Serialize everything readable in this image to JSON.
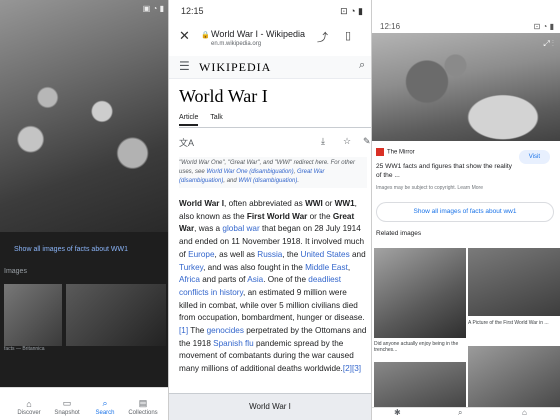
{
  "left": {
    "status_icons": "▣ ◔ ▮",
    "show_all": "Show all images of facts about WW1",
    "section": "Images",
    "thumb_caption": "facts — Britannica",
    "nav": [
      {
        "icon": "⌂",
        "label": "Discover"
      },
      {
        "icon": "▭",
        "label": "Snapshot"
      },
      {
        "icon": "⌕",
        "label": "Search"
      },
      {
        "icon": "▤",
        "label": "Collections"
      }
    ]
  },
  "mid": {
    "status_time": "12:15",
    "status_right": "⊡ ◔ ▮",
    "browser": {
      "close": "✕",
      "lock": "🔒",
      "title": "World War I - Wikipedia",
      "url": "en.m.wikipedia.org",
      "share": "⤴",
      "bookmark": "▯"
    },
    "wiki": {
      "menu": "☰",
      "logo": "WIKIPEDIA",
      "search": "⌕",
      "heading": "World War I",
      "tabs": [
        "Article",
        "Talk"
      ],
      "tools": {
        "lang": "文A",
        "download": "⤓",
        "star": "☆",
        "edit": "✎"
      },
      "hatnote_1": "\"World War One\", \"Great War\", and \"WWI\" redirect here. For other uses, see ",
      "hatnote_link_1": "World War One (disambiguation)",
      "hatnote_2": ", ",
      "hatnote_link_2": "Great War (disambiguation)",
      "hatnote_3": ", and ",
      "hatnote_link_3": "WWI (disambiguation)",
      "hatnote_end": ".",
      "body": [
        {
          "t": "b",
          "v": "World War I"
        },
        {
          "t": "",
          "v": ", often abbreviated as "
        },
        {
          "t": "b",
          "v": "WWI"
        },
        {
          "t": "",
          "v": " or "
        },
        {
          "t": "b",
          "v": "WW1"
        },
        {
          "t": "",
          "v": ", also known as the "
        },
        {
          "t": "b",
          "v": "First World War"
        },
        {
          "t": "",
          "v": " or the "
        },
        {
          "t": "b",
          "v": "Great War"
        },
        {
          "t": "",
          "v": ", was a "
        },
        {
          "t": "a",
          "v": "global war"
        },
        {
          "t": "",
          "v": " that began on 28 July 1914 and ended on 11 November 1918. It involved much of "
        },
        {
          "t": "a",
          "v": "Europe"
        },
        {
          "t": "",
          "v": ", as well as "
        },
        {
          "t": "a",
          "v": "Russia"
        },
        {
          "t": "",
          "v": ", the "
        },
        {
          "t": "a",
          "v": "United States"
        },
        {
          "t": "",
          "v": " and "
        },
        {
          "t": "a",
          "v": "Turkey"
        },
        {
          "t": "",
          "v": ", and was also fought in the "
        },
        {
          "t": "a",
          "v": "Middle East"
        },
        {
          "t": "",
          "v": ", "
        },
        {
          "t": "a",
          "v": "Africa"
        },
        {
          "t": "",
          "v": " and parts of "
        },
        {
          "t": "a",
          "v": "Asia"
        },
        {
          "t": "",
          "v": ". One of the "
        },
        {
          "t": "a",
          "v": "deadliest conflicts in history"
        },
        {
          "t": "",
          "v": ", an estimated 9 million were killed in combat, while over 5 million civilians died from occupation, bombardment, hunger or disease."
        },
        {
          "t": "a",
          "v": "[1]"
        },
        {
          "t": "",
          "v": " The "
        },
        {
          "t": "a",
          "v": "genocides"
        },
        {
          "t": "",
          "v": " perpetrated by the Ottomans and the 1918 "
        },
        {
          "t": "a",
          "v": "Spanish flu"
        },
        {
          "t": "",
          "v": " pandemic spread by the movement of combatants during the war caused many millions of additional deaths worldwide."
        },
        {
          "t": "a",
          "v": "[2][3]"
        }
      ],
      "footer": "World War I"
    }
  },
  "right": {
    "status_time": "12:16",
    "status_right": "⊡ ◔ ▮",
    "photo_icons": "⤢ ⋮",
    "source": "The Mirror",
    "visit": "Visit",
    "caption": "25 WW1 facts and figures that show the reality of the ...",
    "copyright": "Images may be subject to copyright. Learn More",
    "show_all": "Show all images of facts about ww1",
    "related": "Related images",
    "thumb_caption_1": "Did anyone actually enjoy being in the trenches...",
    "thumb_caption_2": "A Picture of the First World War in ...",
    "bottom_icons": [
      "✱",
      "⌕",
      "⌂"
    ]
  }
}
